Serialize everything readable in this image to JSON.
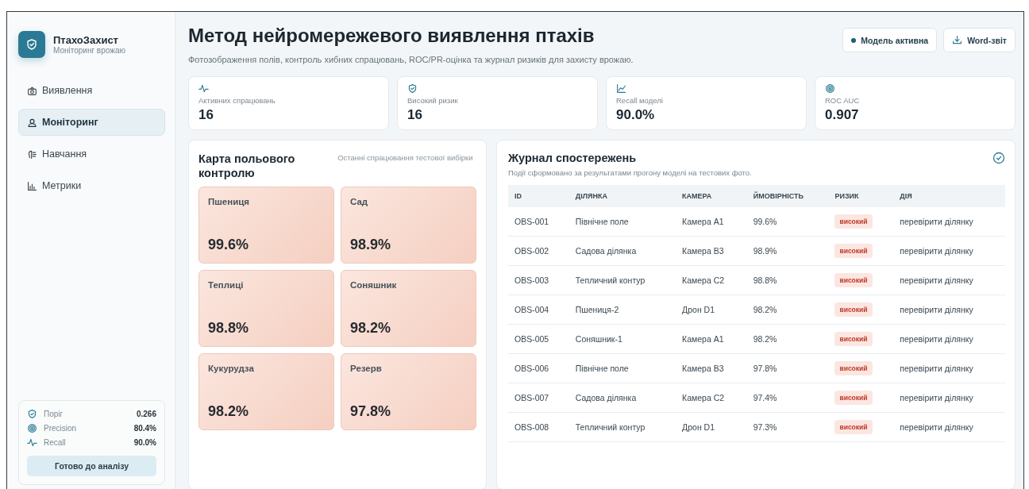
{
  "brand": {
    "name": "ПтахоЗахист",
    "subtitle": "Моніторинг врожаю"
  },
  "nav": [
    {
      "label": "Виявлення",
      "selected": false
    },
    {
      "label": "Моніторинг",
      "selected": true
    },
    {
      "label": "Навчання",
      "selected": false
    },
    {
      "label": "Метрики",
      "selected": false
    }
  ],
  "sidebar_stats": [
    {
      "label": "Поріг",
      "value": "0.266"
    },
    {
      "label": "Precision",
      "value": "80.4%"
    },
    {
      "label": "Recall",
      "value": "90.0%"
    }
  ],
  "status_button": "Готово до аналізу",
  "header": {
    "title": "Метод нейромережевого виявлення птахів",
    "subtitle": "Фотозображення полів, контроль хибних спрацювань, ROC/PR-оцінка та журнал ризиків для захисту врожаю.",
    "model_badge": "Модель активна",
    "report_button": "Word-звіт"
  },
  "kpis": [
    {
      "label": "Активних спрацювань",
      "value": "16"
    },
    {
      "label": "Високий ризик",
      "value": "16"
    },
    {
      "label": "Recall моделі",
      "value": "90.0%"
    },
    {
      "label": "ROC AUC",
      "value": "0.907"
    }
  ],
  "field_map": {
    "title": "Карта польового контролю",
    "note": "Останні спрацювання тестової вибірки",
    "tiles": [
      {
        "name": "Пшениця",
        "value": "99.6%"
      },
      {
        "name": "Сад",
        "value": "98.9%"
      },
      {
        "name": "Теплиці",
        "value": "98.8%"
      },
      {
        "name": "Соняшник",
        "value": "98.2%"
      },
      {
        "name": "Кукурудза",
        "value": "98.2%"
      },
      {
        "name": "Резерв",
        "value": "97.8%"
      }
    ]
  },
  "journal": {
    "title": "Журнал спостережень",
    "subtitle": "Події сформовано за результатами прогону моделі на тестових фото.",
    "columns": [
      "ID",
      "ДІЛЯНКА",
      "КАМЕРА",
      "ЙМОВІРНІСТЬ",
      "РИЗИК",
      "ДІЯ"
    ],
    "rows": [
      {
        "id": "OBS-001",
        "site": "Північне поле",
        "camera": "Камера A1",
        "probability": "99.6%",
        "risk": "високий",
        "action": "перевірити ділянку"
      },
      {
        "id": "OBS-002",
        "site": "Садова ділянка",
        "camera": "Камера B3",
        "probability": "98.9%",
        "risk": "високий",
        "action": "перевірити ділянку"
      },
      {
        "id": "OBS-003",
        "site": "Тепличний контур",
        "camera": "Камера C2",
        "probability": "98.8%",
        "risk": "високий",
        "action": "перевірити ділянку"
      },
      {
        "id": "OBS-004",
        "site": "Пшениця-2",
        "camera": "Дрон D1",
        "probability": "98.2%",
        "risk": "високий",
        "action": "перевірити ділянку"
      },
      {
        "id": "OBS-005",
        "site": "Соняшник-1",
        "camera": "Камера A1",
        "probability": "98.2%",
        "risk": "високий",
        "action": "перевірити ділянку"
      },
      {
        "id": "OBS-006",
        "site": "Північне поле",
        "camera": "Камера B3",
        "probability": "97.8%",
        "risk": "високий",
        "action": "перевірити ділянку"
      },
      {
        "id": "OBS-007",
        "site": "Садова ділянка",
        "camera": "Камера C2",
        "probability": "97.4%",
        "risk": "високий",
        "action": "перевірити ділянку"
      },
      {
        "id": "OBS-008",
        "site": "Тепличний контур",
        "camera": "Дрон D1",
        "probability": "97.3%",
        "risk": "високий",
        "action": "перевірити ділянку"
      }
    ]
  }
}
